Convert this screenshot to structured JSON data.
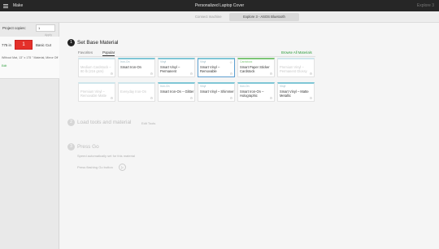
{
  "titlebar": {
    "menu_label": "Make",
    "title": "Personalized Laptop Cover",
    "device_label": "Explore 3"
  },
  "topbar": {
    "connect_label": "Connect machine",
    "machine_label": "Explore 3 - ASOS Bluetooth"
  },
  "sidebar": {
    "copies_label": "Project copies:",
    "copies_value": "1",
    "apply_label": "Apply",
    "mat": {
      "size": "775 in",
      "mat_number": "1",
      "cut_label": "Basic Cut",
      "mat_description": "Without Mat, 13\" x 175 \" Material, Mirror Off",
      "edit_label": "Edit"
    }
  },
  "step1": {
    "number": "1",
    "title": "Set Base Material",
    "tabs": [
      "Favorites",
      "Popular"
    ],
    "browse_label": "Browse All Materials",
    "materials_row1": [
      {
        "category": "",
        "name": "Medium Cardstock – 80 lb (216 gsm)",
        "state": "faded"
      },
      {
        "category": "Iron-On",
        "name": "Smart Iron-On",
        "state": "normal"
      },
      {
        "category": "Vinyl",
        "name": "Smart Vinyl – Permanent",
        "state": "normal"
      },
      {
        "category": "Vinyl",
        "name": "Smart Vinyl – Removable",
        "state": "selected"
      },
      {
        "category": "Cardstock",
        "name": "Smart Paper Sticker Cardstock",
        "state": "green"
      },
      {
        "category": "",
        "name": "Premium Vinyl – Permanent Glossy",
        "state": "faded"
      }
    ],
    "materials_row2": [
      {
        "category": "",
        "name": "Premium Vinyl – Removable Matte",
        "state": "faded"
      },
      {
        "category": "",
        "name": "Everyday Iron-On",
        "state": "faded"
      },
      {
        "category": "Iron-On",
        "name": "Smart Iron-On – Glitter",
        "state": "normal"
      },
      {
        "category": "Vinyl",
        "name": "Smart Vinyl – Shimmer",
        "state": "normal"
      },
      {
        "category": "Iron-On",
        "name": "Smart Iron-On – Holographic",
        "state": "normal"
      },
      {
        "category": "Vinyl",
        "name": "Smart Vinyl – Matte Metallic",
        "state": "normal"
      }
    ]
  },
  "step2": {
    "number": "2",
    "title": "Load tools and material",
    "edit_tools": "Edit Tools"
  },
  "step3": {
    "number": "3",
    "title": "Press Go",
    "line1": "Speed automatically set for this material",
    "line2": "Press flashing Go button"
  },
  "colors": {
    "titlebar": "#262626",
    "mat_red": "#e4302a",
    "link_green": "#2b9c3a",
    "card_accent": "#7fc6d6"
  }
}
